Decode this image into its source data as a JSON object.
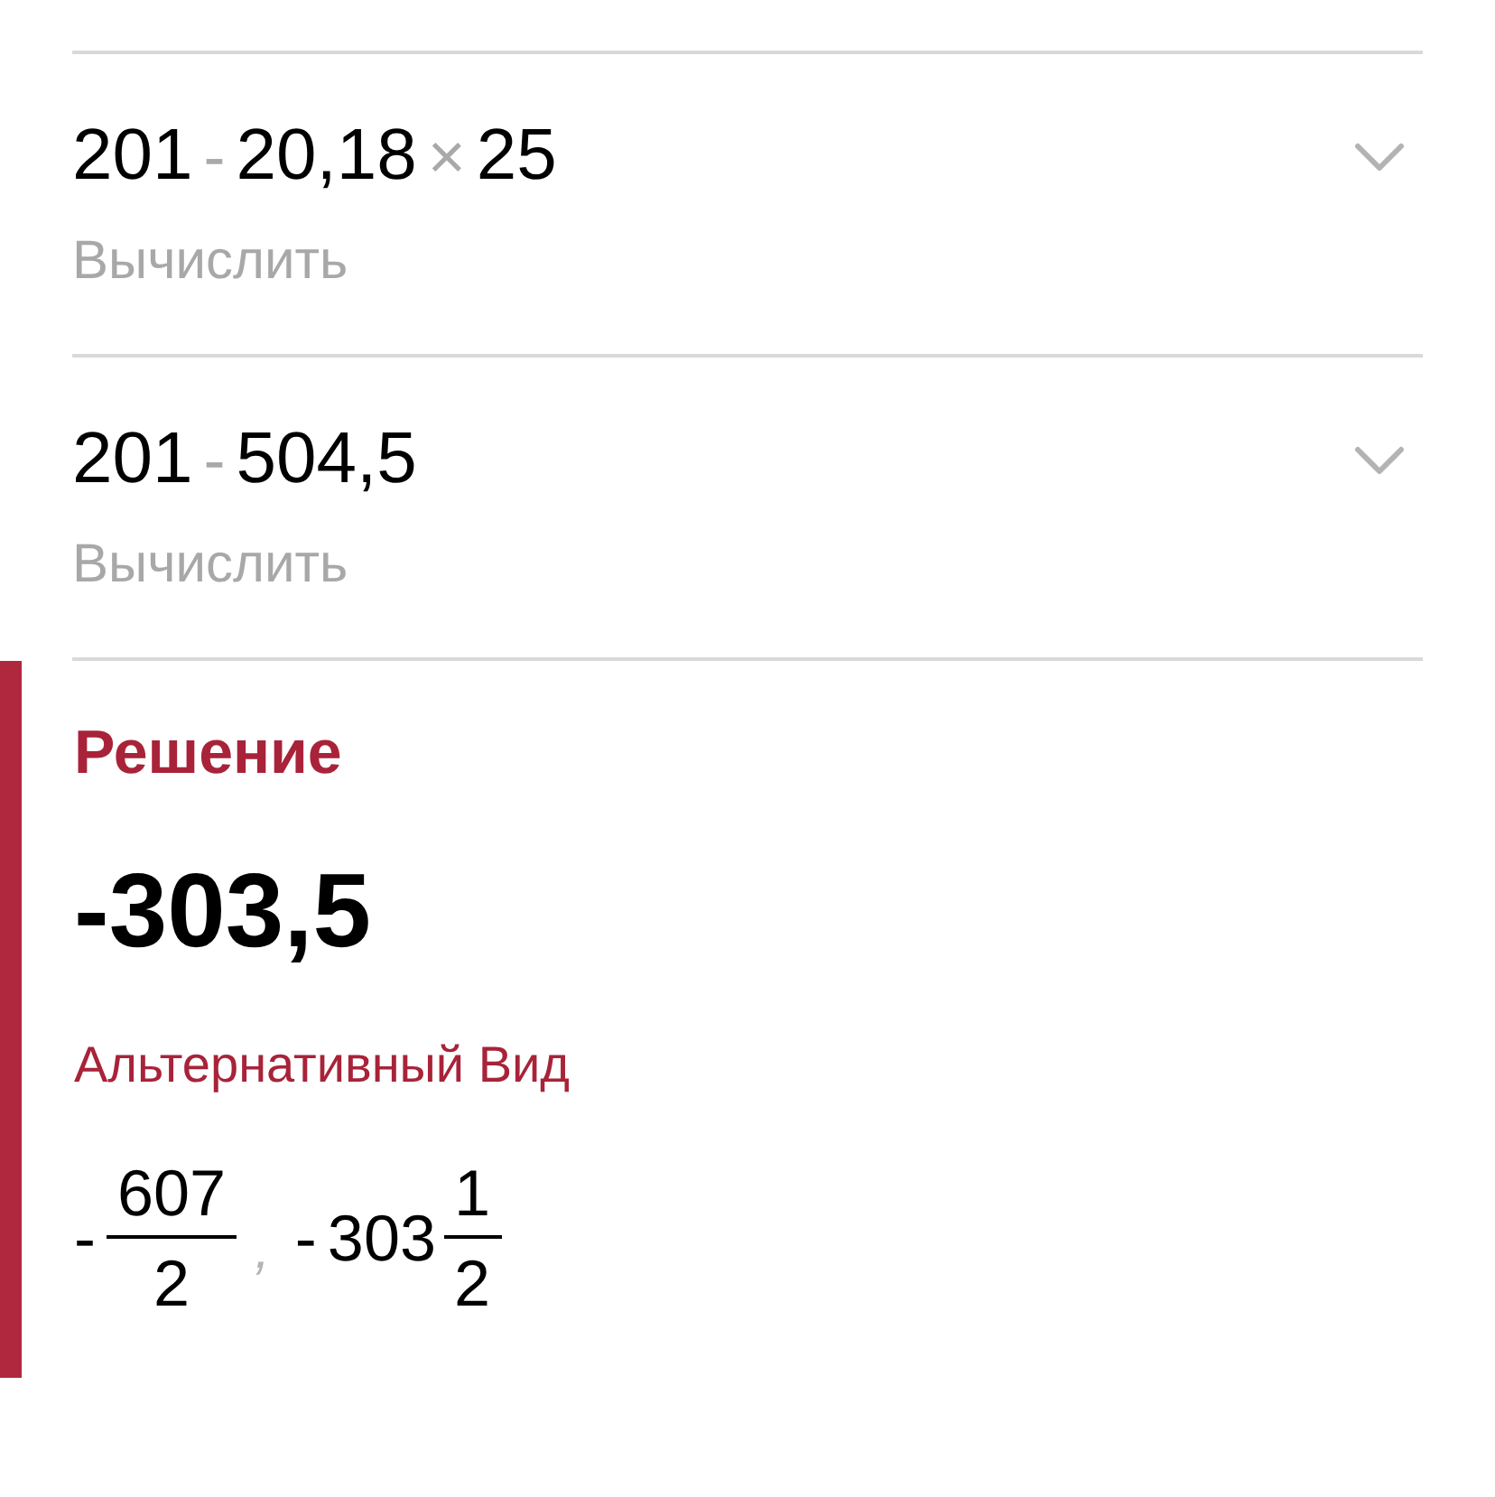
{
  "steps": [
    {
      "expression": [
        {
          "kind": "number",
          "text": "201"
        },
        {
          "kind": "operator",
          "text": "-"
        },
        {
          "kind": "number",
          "text": "20,18"
        },
        {
          "kind": "operator",
          "text": "×"
        },
        {
          "kind": "number",
          "text": "25"
        }
      ],
      "label": "Вычислить",
      "expanded": false
    },
    {
      "expression": [
        {
          "kind": "number",
          "text": "201"
        },
        {
          "kind": "operator",
          "text": "-"
        },
        {
          "kind": "number",
          "text": "504,5"
        }
      ],
      "label": "Вычислить",
      "expanded": false
    }
  ],
  "solution": {
    "title": "Решение",
    "result": "-303,5",
    "alternative_title": "Альтернативный Вид",
    "alternatives": [
      {
        "kind": "fraction",
        "sign": "-",
        "numerator": "607",
        "denominator": "2"
      },
      {
        "kind": "separator",
        "text": ","
      },
      {
        "kind": "mixed",
        "sign": "-",
        "whole": "303",
        "numerator": "1",
        "denominator": "2"
      }
    ]
  }
}
